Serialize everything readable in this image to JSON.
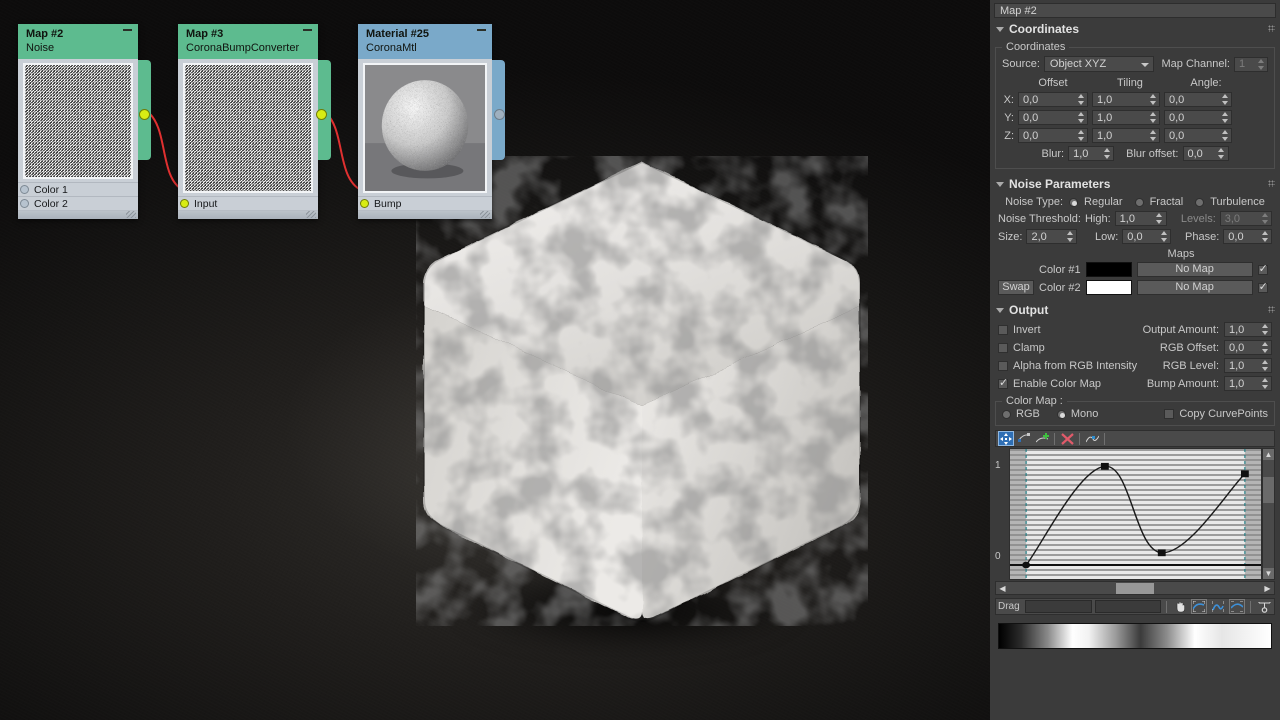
{
  "panel": {
    "map_name": "Map #2",
    "coordinates": {
      "title": "Coordinates",
      "group_legend": "Coordinates",
      "source_label": "Source:",
      "source_value": "Object XYZ",
      "map_channel_label": "Map Channel:",
      "map_channel_value": "1",
      "col_offset": "Offset",
      "col_tiling": "Tiling",
      "col_angle": "Angle:",
      "axis_x": "X:",
      "axis_y": "Y:",
      "axis_z": "Z:",
      "offset_x": "0,0",
      "offset_y": "0,0",
      "offset_z": "0,0",
      "tiling_x": "1,0",
      "tiling_y": "1,0",
      "tiling_z": "1,0",
      "angle_x": "0,0",
      "angle_y": "0,0",
      "angle_z": "0,0",
      "blur_label": "Blur:",
      "blur_value": "1,0",
      "blur_offset_label": "Blur offset:",
      "blur_offset_value": "0,0"
    },
    "noise": {
      "title": "Noise Parameters",
      "noise_type_label": "Noise Type:",
      "type_regular": "Regular",
      "type_fractal": "Fractal",
      "type_turbulence": "Turbulence",
      "threshold_label": "Noise Threshold:",
      "high_label": "High:",
      "high_value": "1,0",
      "levels_label": "Levels:",
      "levels_value": "3,0",
      "size_label": "Size:",
      "size_value": "2,0",
      "low_label": "Low:",
      "low_value": "0,0",
      "phase_label": "Phase:",
      "phase_value": "0,0",
      "maps_header": "Maps",
      "swap_label": "Swap",
      "color1_label": "Color #1",
      "color1_hex": "#000000",
      "color1_map": "No Map",
      "color2_label": "Color #2",
      "color2_hex": "#ffffff",
      "color2_map": "No Map"
    },
    "output": {
      "title": "Output",
      "invert_label": "Invert",
      "clamp_label": "Clamp",
      "alpha_label": "Alpha from RGB Intensity",
      "enable_color_map_label": "Enable Color Map",
      "output_amount_label": "Output Amount:",
      "output_amount_value": "1,0",
      "rgb_offset_label": "RGB Offset:",
      "rgb_offset_value": "0,0",
      "rgb_level_label": "RGB Level:",
      "rgb_level_value": "1,0",
      "bump_amount_label": "Bump Amount:",
      "bump_amount_value": "1,0",
      "color_map_legend": "Color Map :",
      "rgb_radio_label": "RGB",
      "mono_radio_label": "Mono",
      "copy_curve_points_label": "Copy CurvePoints",
      "drag_label": "Drag",
      "drag_field_1": "",
      "drag_field_2": "",
      "y_max": "1",
      "y_min": "0"
    }
  },
  "nodes": [
    {
      "id": "map2",
      "title": "Map #2",
      "subtitle": "Noise",
      "header_color": "#5dbb8f",
      "outputs": [
        "out"
      ],
      "inputs": [
        "Color 1",
        "Color 2"
      ]
    },
    {
      "id": "map3",
      "title": "Map #3",
      "subtitle": "CoronaBumpConverter",
      "header_color": "#5dbb8f",
      "outputs": [
        "out"
      ],
      "inputs": [
        "Input"
      ]
    },
    {
      "id": "material25",
      "title": "Material #25",
      "subtitle": "CoronaMtl",
      "header_color": "#7aa9c9",
      "outputs": [
        "out"
      ],
      "inputs": [
        "Bump"
      ]
    }
  ],
  "chart_data": {
    "type": "line",
    "title": "Color Map Curve",
    "xlabel": "",
    "ylabel": "",
    "xlim": [
      0,
      1
    ],
    "ylim": [
      0,
      1
    ],
    "grid": true,
    "points": [
      {
        "x": 0.0,
        "y": 0.0
      },
      {
        "x": 0.36,
        "y": 1.05
      },
      {
        "x": 0.62,
        "y": 0.13
      },
      {
        "x": 1.0,
        "y": 0.97
      }
    ],
    "y_ticks": [
      "0",
      "1"
    ]
  }
}
